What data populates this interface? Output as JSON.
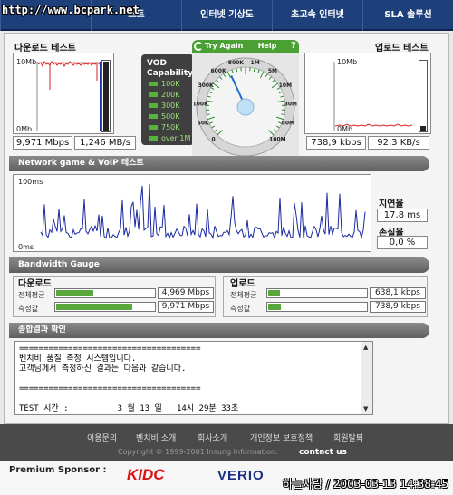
{
  "nav": {
    "url_overlay": "http://www.bcpark.net",
    "items": [
      "",
      "스트",
      "인터넷 기상도",
      "초고속 인터넷",
      "SLA 솔루션"
    ]
  },
  "download": {
    "title": "다운로드 테스트",
    "top_label": "10Mb",
    "bottom_label": "0Mb",
    "mbps": "9,971 Mbps",
    "mbs": "1,246 MB/s"
  },
  "upload": {
    "title": "업로드 테스트",
    "top_label": "10Mb",
    "bottom_label": "0Mb",
    "kbps": "738,9 kbps",
    "kbs": "92,3 KB/s"
  },
  "vod": {
    "title_line1": "VOD",
    "title_line2": "Capability",
    "levels": [
      "100K",
      "200K",
      "300K",
      "500K",
      "750K",
      "over 1M"
    ]
  },
  "gauge": {
    "try_again": "Try Again",
    "help": "Help",
    "help_icon": "?",
    "ticks": [
      "0",
      "50K",
      "100K",
      "300K",
      "600K",
      "800K",
      "1M",
      "5M",
      "10M",
      "30M",
      "80M",
      "100M"
    ],
    "needle_value": "600K"
  },
  "network": {
    "title": "Network game & VoIP 테스트",
    "top_label": "100ms",
    "bottom_label": "0ms",
    "latency_label": "지연율",
    "latency_value": "17,8 ms",
    "loss_label": "손실율",
    "loss_value": "0,0 %"
  },
  "bandwidth": {
    "title": "Bandwidth Gauge",
    "download": {
      "title": "다운로드",
      "avg_label": "전체평균",
      "avg_value": "4,969 Mbps",
      "avg_fill": 0.38,
      "measured_label": "측정값",
      "measured_value": "9,971 Mbps",
      "measured_fill": 0.78
    },
    "upload": {
      "title": "업로드",
      "avg_label": "전체평균",
      "avg_value": "638,1 kbps",
      "avg_fill": 0.12,
      "measured_label": "측정값",
      "measured_value": "738,9 kbps",
      "measured_fill": 0.13
    }
  },
  "result": {
    "title": "종합결과 확인",
    "text": "=====================================\n벤치비 품질 측정 시스템입니다.\n고객님께서 측정하신 결과는 다음과 같습니다.\n\n=====================================\n\nTEST 시간 :          3 월 13 일   14시 29분 33초"
  },
  "footer": {
    "links": [
      "이용문의",
      "벤치비 소개",
      "회사소개",
      "개인정보 보호정책",
      "회원탈퇴"
    ],
    "copyright": "Copyright © 1999-2001 Insung Information.",
    "contact": "contact us",
    "sponsor_label": "Premium Sponsor :",
    "sponsors": [
      "KIDC",
      "VERIO"
    ],
    "stamp": "하늘사랑 / 2003-03-13 14:38:45"
  }
}
